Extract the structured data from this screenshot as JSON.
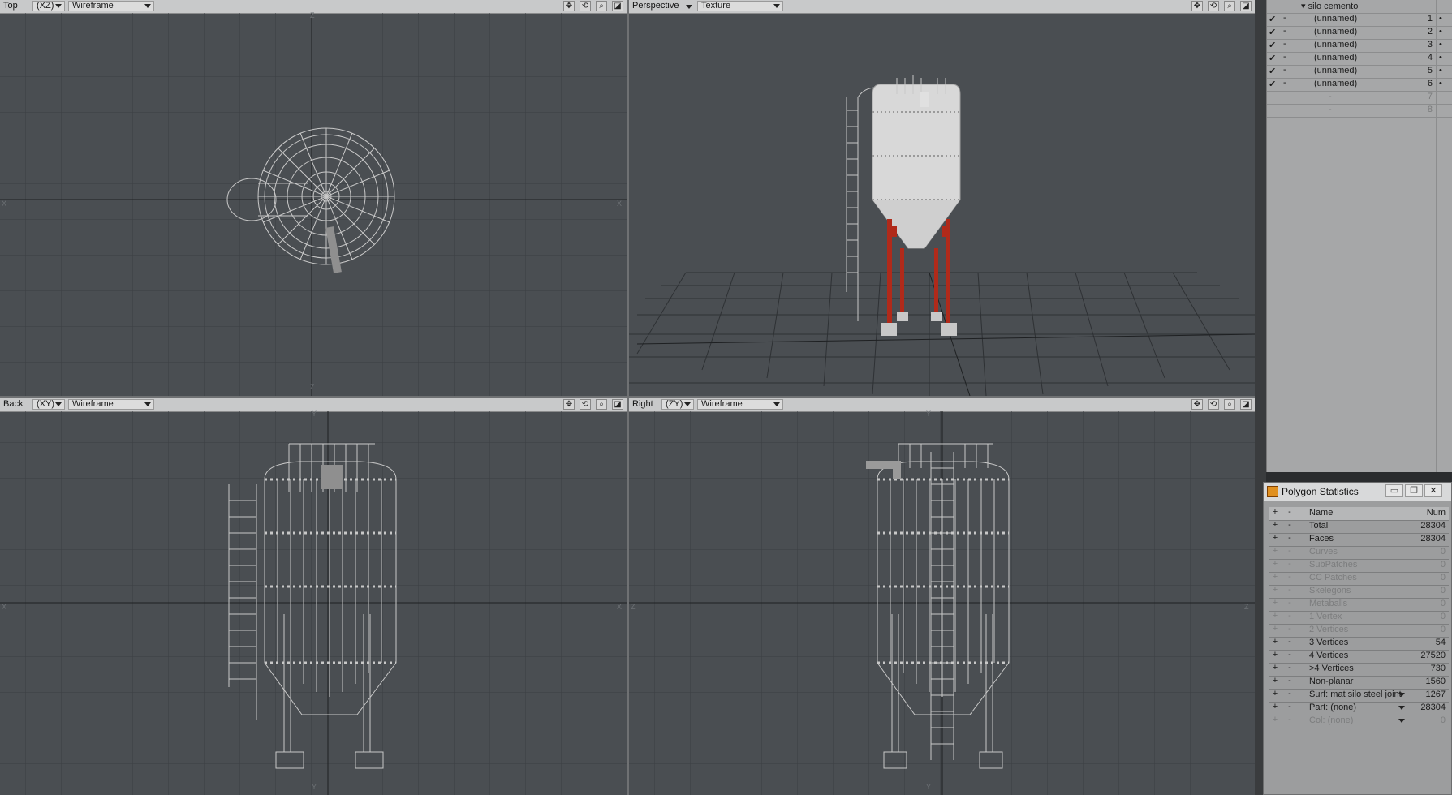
{
  "viewports": {
    "top": {
      "name": "Top",
      "axis": "(XZ)",
      "mode": "Wireframe"
    },
    "perspective": {
      "name": "Perspective",
      "mode": "Texture"
    },
    "back": {
      "name": "Back",
      "axis": "(XY)",
      "mode": "Wireframe"
    },
    "right": {
      "name": "Right",
      "axis": "(ZY)",
      "mode": "Wireframe"
    }
  },
  "axis_labels": {
    "z": "Z",
    "x": "X",
    "y": "Y"
  },
  "viewport_controls": [
    "move-icon",
    "rotate-icon",
    "zoom-icon",
    "maximize-icon"
  ],
  "scene": {
    "root": "silo cemento",
    "items": [
      {
        "name": "(unnamed)",
        "num": "1"
      },
      {
        "name": "(unnamed)",
        "num": "2"
      },
      {
        "name": "(unnamed)",
        "num": "3"
      },
      {
        "name": "(unnamed)",
        "num": "4"
      },
      {
        "name": "(unnamed)",
        "num": "5"
      },
      {
        "name": "(unnamed)",
        "num": "6"
      },
      {
        "name": "-",
        "num": "7"
      },
      {
        "name": "-",
        "num": "8"
      }
    ]
  },
  "stats": {
    "title": "Polygon Statistics",
    "col_name": "Name",
    "col_num": "Num",
    "rows": [
      {
        "name": "Total",
        "num": "28304",
        "dim": false
      },
      {
        "name": "Faces",
        "num": "28304",
        "dim": false
      },
      {
        "name": "Curves",
        "num": "0",
        "dim": true
      },
      {
        "name": "SubPatches",
        "num": "0",
        "dim": true
      },
      {
        "name": "CC Patches",
        "num": "0",
        "dim": true
      },
      {
        "name": "Skelegons",
        "num": "0",
        "dim": true
      },
      {
        "name": "Metaballs",
        "num": "0",
        "dim": true
      },
      {
        "name": "1 Vertex",
        "num": "0",
        "dim": true
      },
      {
        "name": "2 Vertices",
        "num": "0",
        "dim": true
      },
      {
        "name": "3 Vertices",
        "num": "54",
        "dim": false
      },
      {
        "name": "4 Vertices",
        "num": "27520",
        "dim": false
      },
      {
        "name": ">4 Vertices",
        "num": "730",
        "dim": false
      },
      {
        "name": "Non-planar",
        "num": "1560",
        "dim": false
      },
      {
        "name": "Surf: mat silo steel joint",
        "num": "1267",
        "dim": false
      },
      {
        "name": "Part: (none)",
        "num": "28304",
        "dim": false
      },
      {
        "name": "Col: (none)",
        "num": "0",
        "dim": true
      }
    ]
  },
  "colors": {
    "viewport": "#4a4e52",
    "grid": "#3b3e42",
    "wire": "#c8c8c8",
    "silo": "#d9d9d9",
    "legs": "#b02a1a"
  }
}
